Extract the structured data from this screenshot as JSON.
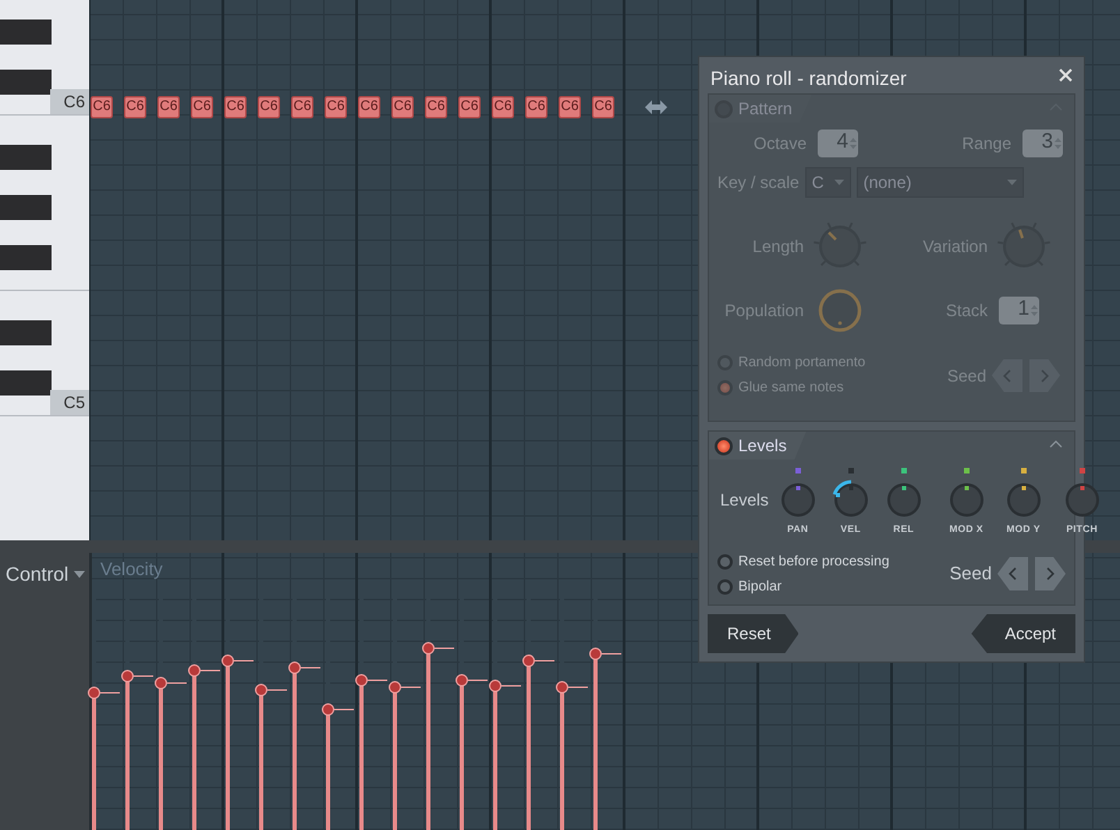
{
  "piano_roll": {
    "key_labels": [
      {
        "label": "C6"
      },
      {
        "label": "C5"
      }
    ],
    "notes": [
      {
        "label": "C6"
      },
      {
        "label": "C6"
      },
      {
        "label": "C6"
      },
      {
        "label": "C6"
      },
      {
        "label": "C6"
      },
      {
        "label": "C6"
      },
      {
        "label": "C6"
      },
      {
        "label": "C6"
      },
      {
        "label": "C6"
      },
      {
        "label": "C6"
      },
      {
        "label": "C6"
      },
      {
        "label": "C6"
      },
      {
        "label": "C6"
      },
      {
        "label": "C6"
      },
      {
        "label": "C6"
      },
      {
        "label": "C6"
      }
    ]
  },
  "control": {
    "label": "Control",
    "parameter": "Velocity",
    "velocities": [
      {
        "level": 0.56
      },
      {
        "level": 0.63
      },
      {
        "level": 0.6
      },
      {
        "level": 0.65
      },
      {
        "level": 0.69
      },
      {
        "level": 0.57
      },
      {
        "level": 0.66
      },
      {
        "level": 0.49
      },
      {
        "level": 0.61
      },
      {
        "level": 0.58
      },
      {
        "level": 0.74
      },
      {
        "level": 0.61
      },
      {
        "level": 0.59
      },
      {
        "level": 0.69
      },
      {
        "level": 0.58
      },
      {
        "level": 0.72
      }
    ]
  },
  "dialog": {
    "title": "Piano roll - randomizer",
    "pattern": {
      "title": "Pattern",
      "enabled": false,
      "octave": {
        "label": "Octave",
        "value": "4"
      },
      "range": {
        "label": "Range",
        "value": "3"
      },
      "key_scale": {
        "label": "Key / scale",
        "key": "C",
        "scale": "(none)"
      },
      "length": {
        "label": "Length"
      },
      "variation": {
        "label": "Variation"
      },
      "population": {
        "label": "Population",
        "highlighted": true
      },
      "stack": {
        "label": "Stack",
        "value": "1"
      },
      "options": [
        {
          "label": "Random portamento",
          "checked": false
        },
        {
          "label": "Glue same notes",
          "checked": true
        }
      ],
      "seed_label": "Seed"
    },
    "levels": {
      "title": "Levels",
      "enabled": true,
      "label": "Levels",
      "knobs": [
        {
          "label": "PAN",
          "color": "#7b5fd8",
          "active": false
        },
        {
          "label": "VEL",
          "color": "#2a2f33",
          "active": true
        },
        {
          "label": "REL",
          "color": "#3cc47c",
          "active": false
        },
        {
          "label": "MOD X",
          "color": "#6cc04a",
          "active": false
        },
        {
          "label": "MOD Y",
          "color": "#d8b040",
          "active": false
        },
        {
          "label": "PITCH",
          "color": "#d04444",
          "active": false
        }
      ],
      "options": [
        {
          "label": "Reset before processing",
          "checked": false
        },
        {
          "label": "Bipolar",
          "checked": false
        }
      ],
      "seed_label": "Seed"
    },
    "buttons": [
      "Reset",
      "Accept"
    ]
  }
}
